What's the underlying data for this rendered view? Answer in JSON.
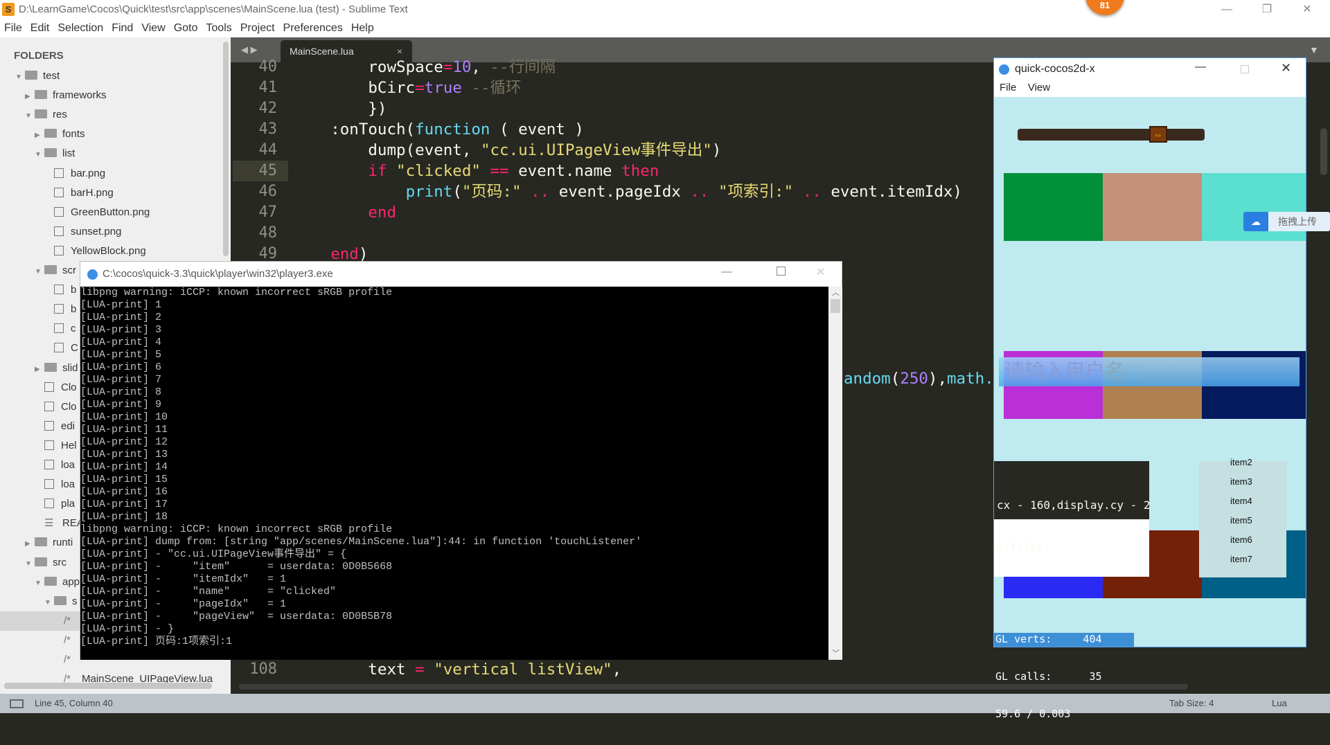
{
  "window": {
    "title": "D:\\LearnGame\\Cocos\\Quick\\test\\src\\app\\scenes\\MainScene.lua (test) - Sublime Text",
    "logo": "S",
    "badge": "81"
  },
  "menu": [
    "File",
    "Edit",
    "Selection",
    "Find",
    "View",
    "Goto",
    "Tools",
    "Project",
    "Preferences",
    "Help"
  ],
  "sidebar": {
    "header": "FOLDERS",
    "items": [
      {
        "label": "test",
        "type": "folder",
        "open": true,
        "depth": 0
      },
      {
        "label": "frameworks",
        "type": "folder",
        "open": false,
        "depth": 1
      },
      {
        "label": "res",
        "type": "folder",
        "open": true,
        "depth": 1
      },
      {
        "label": "fonts",
        "type": "folder",
        "open": false,
        "depth": 2
      },
      {
        "label": "list",
        "type": "folder",
        "open": true,
        "depth": 2
      },
      {
        "label": "bar.png",
        "type": "file",
        "depth": 3
      },
      {
        "label": "barH.png",
        "type": "file",
        "depth": 3
      },
      {
        "label": "GreenButton.png",
        "type": "file",
        "depth": 3
      },
      {
        "label": "sunset.png",
        "type": "file",
        "depth": 3
      },
      {
        "label": "YellowBlock.png",
        "type": "file",
        "depth": 3
      },
      {
        "label": "scr",
        "type": "folder",
        "open": true,
        "depth": 2
      },
      {
        "label": "b",
        "type": "file",
        "depth": 3
      },
      {
        "label": "b",
        "type": "file",
        "depth": 3
      },
      {
        "label": "c",
        "type": "file",
        "depth": 3
      },
      {
        "label": "C",
        "type": "file",
        "depth": 3
      },
      {
        "label": "slid",
        "type": "folder",
        "open": false,
        "depth": 2
      },
      {
        "label": "Clo",
        "type": "file",
        "depth": 2
      },
      {
        "label": "Clo",
        "type": "file",
        "depth": 2
      },
      {
        "label": "edi",
        "type": "file",
        "depth": 2
      },
      {
        "label": "Hel",
        "type": "file",
        "depth": 2
      },
      {
        "label": "loa",
        "type": "file",
        "depth": 2
      },
      {
        "label": "loa",
        "type": "file",
        "depth": 2
      },
      {
        "label": "pla",
        "type": "file",
        "depth": 2
      },
      {
        "label": "REA",
        "type": "text",
        "depth": 2
      },
      {
        "label": "runti",
        "type": "folder",
        "open": false,
        "depth": 1
      },
      {
        "label": "src",
        "type": "folder",
        "open": true,
        "depth": 1
      },
      {
        "label": "app",
        "type": "folder",
        "open": true,
        "depth": 2
      },
      {
        "label": "s",
        "type": "folder",
        "open": true,
        "depth": 3
      },
      {
        "label": "",
        "type": "lua",
        "depth": 4,
        "selected": true
      },
      {
        "label": "",
        "type": "lua",
        "depth": 4
      },
      {
        "label": "",
        "type": "lua",
        "depth": 4
      },
      {
        "label": "MainScene_UIPageView.lua",
        "type": "lua",
        "depth": 4
      }
    ]
  },
  "tab": {
    "label": "MainScene.lua",
    "close": "×"
  },
  "editor": {
    "lines": [
      {
        "n": "40",
        "indent": 8,
        "t": [
          [
            "rowSpace",
            ""
          ],
          [
            "=",
            "k"
          ],
          [
            "10",
            "n"
          ],
          [
            ", ",
            ""
          ],
          [
            "--行间隔",
            "c"
          ]
        ]
      },
      {
        "n": "41",
        "indent": 8,
        "t": [
          [
            "bCirc",
            ""
          ],
          [
            "=",
            "k"
          ],
          [
            "true",
            "n"
          ],
          [
            " --循环",
            "c"
          ]
        ]
      },
      {
        "n": "42",
        "indent": 8,
        "t": [
          [
            "})",
            ""
          ]
        ]
      },
      {
        "n": "43",
        "indent": 4,
        "t": [
          [
            ":onTouch(",
            ""
          ],
          [
            "function",
            "f"
          ],
          [
            " ( event )",
            ""
          ]
        ]
      },
      {
        "n": "44",
        "indent": 8,
        "t": [
          [
            "dump(event, ",
            ""
          ],
          [
            "\"cc.ui.UIPageView事件导出\"",
            "s"
          ],
          [
            ")",
            ""
          ]
        ]
      },
      {
        "n": "45",
        "indent": 8,
        "t": [
          [
            "if",
            "k"
          ],
          [
            " ",
            ""
          ],
          [
            "\"clicked\"",
            "s"
          ],
          [
            " ",
            ""
          ],
          [
            "==",
            "k"
          ],
          [
            " event.name ",
            ""
          ],
          [
            "then",
            "k"
          ]
        ]
      },
      {
        "n": "46",
        "indent": 12,
        "t": [
          [
            "print",
            "f"
          ],
          [
            "(",
            ""
          ],
          [
            "\"页码:\"",
            "s"
          ],
          [
            " ",
            ""
          ],
          [
            "..",
            "k"
          ],
          [
            " event.pageIdx ",
            ""
          ],
          [
            "..",
            "k"
          ],
          [
            " ",
            ""
          ],
          [
            "\"项索引:\"",
            "s"
          ],
          [
            " ",
            ""
          ],
          [
            "..",
            "k"
          ],
          [
            " event.itemIdx)",
            ""
          ]
        ]
      },
      {
        "n": "47",
        "indent": 8,
        "t": [
          [
            "end",
            "k"
          ]
        ]
      },
      {
        "n": "48",
        "indent": 0,
        "t": []
      },
      {
        "n": "49",
        "indent": 4,
        "t": [
          [
            "end",
            "k"
          ],
          [
            ")",
            ""
          ]
        ]
      }
    ],
    "fragment55": [
      [
        "andom",
        "f"
      ],
      [
        "(",
        ""
      ],
      [
        "250",
        "n"
      ],
      [
        "),",
        ""
      ],
      [
        "math.",
        "f"
      ]
    ],
    "line108": {
      "n": "108",
      "indent": 8,
      "t": [
        [
          "text ",
          ""
        ],
        [
          "=",
          "k"
        ],
        [
          " ",
          ""
        ],
        [
          "\"vertical listView\"",
          "s"
        ],
        [
          ",",
          ""
        ]
      ]
    }
  },
  "status": {
    "position": "Line 45, Column 40",
    "tab_size": "Tab Size: 4",
    "syntax": "Lua"
  },
  "console": {
    "title": "C:\\cocos\\quick-3.3\\quick\\player\\win32\\player3.exe",
    "lines": [
      "libpng warning: iCCP: known incorrect sRGB profile",
      "[LUA-print] 1",
      "[LUA-print] 2",
      "[LUA-print] 3",
      "[LUA-print] 4",
      "[LUA-print] 5",
      "[LUA-print] 6",
      "[LUA-print] 7",
      "[LUA-print] 8",
      "[LUA-print] 9",
      "[LUA-print] 10",
      "[LUA-print] 11",
      "[LUA-print] 12",
      "[LUA-print] 13",
      "[LUA-print] 14",
      "[LUA-print] 15",
      "[LUA-print] 16",
      "[LUA-print] 17",
      "[LUA-print] 18",
      "libpng warning: iCCP: known incorrect sRGB profile",
      "[LUA-print] dump from: [string \"app/scenes/MainScene.lua\"]:44: in function 'touchListener'",
      "[LUA-print] - \"cc.ui.UIPageView事件导出\" = {",
      "[LUA-print] -     \"item\"      = userdata: 0D0B5668",
      "[LUA-print] -     \"itemIdx\"   = 1",
      "[LUA-print] -     \"name\"      = \"clicked\"",
      "[LUA-print] -     \"pageIdx\"   = 1",
      "[LUA-print] -     \"pageView\"  = userdata: 0D0B5B78",
      "[LUA-print] - }",
      "[LUA-print] 页码:1项索引:1"
    ]
  },
  "cocos": {
    "title": "quick-cocos2d-x",
    "menu": [
      "File",
      "View"
    ],
    "slider_value": 0.75,
    "input_placeholder": "请输入用户名",
    "rows": [
      [
        "#008f3a",
        "#c49078",
        "#5adfd0"
      ],
      [
        "#bb2fd6",
        "#b08050",
        "#061a5e"
      ],
      [
        "#2a2af5",
        "#74210a",
        "#006088"
      ]
    ],
    "list_items": [
      "item2",
      "item3",
      "item4",
      "item5",
      "item6",
      "item7"
    ],
    "code_overlay": [
      "cx - 160,display.cy - 2",
      "e(false)"
    ],
    "stats": [
      "GL verts:     404",
      "GL calls:      35",
      "59.6 / 0.003"
    ]
  },
  "baidu": {
    "label": "拖拽上传"
  }
}
